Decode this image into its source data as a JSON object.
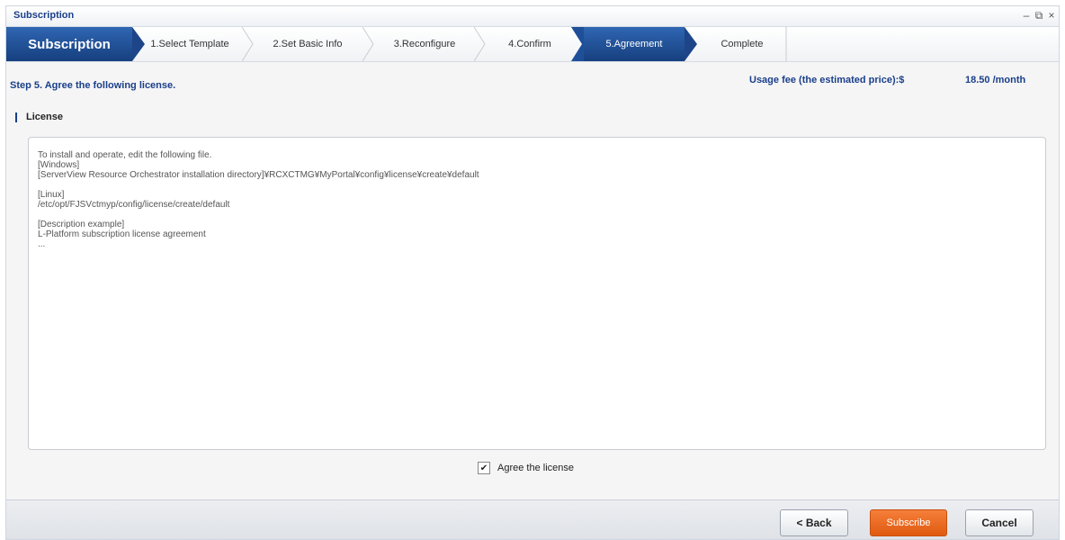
{
  "window": {
    "title": "Subscription",
    "controls": {
      "minimize": "–",
      "restore": "⧉",
      "close": "×"
    }
  },
  "wizard": {
    "title": "Subscription",
    "steps": [
      {
        "label": "1.Select Template"
      },
      {
        "label": "2.Set Basic Info"
      },
      {
        "label": "3.Reconfigure"
      },
      {
        "label": "4.Confirm"
      },
      {
        "label": "5.Agreement"
      },
      {
        "label": "Complete"
      }
    ],
    "active_step": "5.Agreement"
  },
  "content": {
    "step_heading": "Step 5. Agree the following license.",
    "fee_label": "Usage fee (the estimated price):$",
    "fee_value": "18.50 /month",
    "section_label": "License",
    "license_text": "To install and operate, edit the following file.\n[Windows]\n[ServerView Resource Orchestrator installation directory]¥RCXCTMG¥MyPortal¥config¥license¥create¥default\n\n[Linux]\n/etc/opt/FJSVctmyp/config/license/create/default\n\n[Description example]\nL-Platform subscription license agreement\n...",
    "agree_label": "Agree the license",
    "agree_checked": true
  },
  "footer": {
    "back_label": "< Back",
    "subscribe_label": "Subscribe",
    "cancel_label": "Cancel"
  },
  "colors": {
    "accent": "#1a3f8a",
    "active_step": "#1f4f99",
    "primary_button": "#e8661f"
  }
}
